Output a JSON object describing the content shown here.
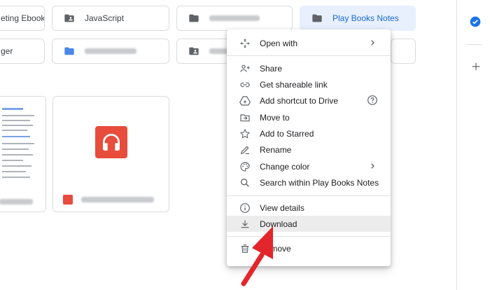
{
  "folders": {
    "row1": [
      "eting Ebooks",
      "JavaScript",
      "",
      "Play Books Notes"
    ],
    "row2": [
      "ger",
      "",
      ""
    ]
  },
  "context_menu": {
    "open_with": "Open with",
    "share": "Share",
    "get_link": "Get shareable link",
    "add_shortcut": "Add shortcut to Drive",
    "move_to": "Move to",
    "add_starred": "Add to Starred",
    "rename": "Rename",
    "change_color": "Change color",
    "search_within": "Search within Play Books Notes",
    "view_details": "View details",
    "download": "Download",
    "remove": "Remove"
  },
  "colors": {
    "accent": "#1a73e8",
    "selected_folder_bg": "#e8f0fe",
    "arrow": "#e3262b",
    "file_icon": "#e74c3c"
  },
  "icons": [
    "folder-icon",
    "shared-folder-icon",
    "open-with-icon",
    "share-icon",
    "link-icon",
    "drive-shortcut-icon",
    "help-icon",
    "move-to-icon",
    "star-icon",
    "rename-icon",
    "palette-icon",
    "search-icon",
    "info-icon",
    "download-icon",
    "trash-icon",
    "chevron-right-icon",
    "plus-icon",
    "tasks-icon"
  ]
}
